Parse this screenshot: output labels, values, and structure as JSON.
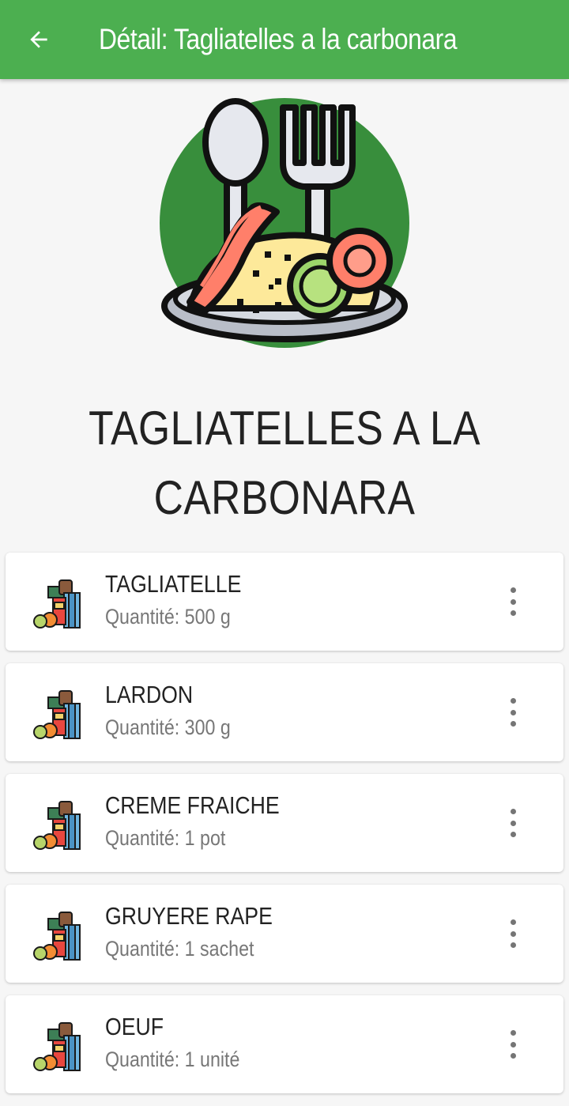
{
  "header": {
    "title": "Détail: Tagliatelles a la carbonara",
    "back_icon": "arrow-left-icon",
    "bg_color": "#4caf50"
  },
  "recipe": {
    "title_line1": "TAGLIATELLES A LA",
    "title_line2": "CARBONARA",
    "image_icon": "plate-with-pasta-spoon-fork-icon"
  },
  "ingredients": [
    {
      "name": "TAGLIATELLE",
      "quantity": "Quantité: 500 g",
      "icon": "groceries-icon",
      "menu_icon": "more-vert-icon"
    },
    {
      "name": "LARDON",
      "quantity": "Quantité: 300 g",
      "icon": "groceries-icon",
      "menu_icon": "more-vert-icon"
    },
    {
      "name": "CREME FRAICHE",
      "quantity": "Quantité: 1 pot",
      "icon": "groceries-icon",
      "menu_icon": "more-vert-icon"
    },
    {
      "name": "GRUYERE RAPE",
      "quantity": "Quantité: 1 sachet",
      "icon": "groceries-icon",
      "menu_icon": "more-vert-icon"
    },
    {
      "name": "OEUF",
      "quantity": "Quantité: 1 unité",
      "icon": "groceries-icon",
      "menu_icon": "more-vert-icon"
    }
  ]
}
